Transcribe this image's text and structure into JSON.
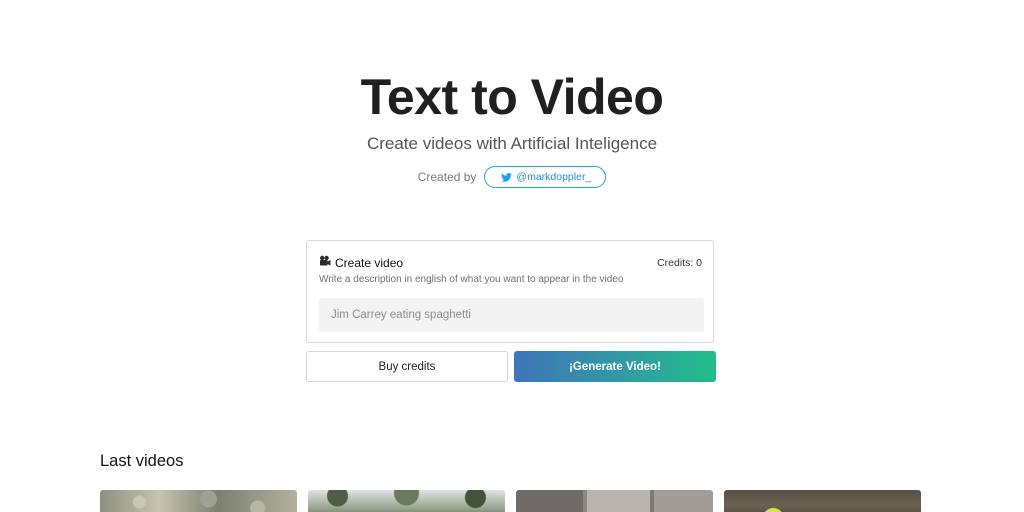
{
  "header": {
    "title": "Text to Video",
    "subtitle": "Create videos with Artificial Inteligence",
    "created_by_label": "Created by",
    "twitter_handle": "@markdoppler_"
  },
  "create_card": {
    "title": "Create video",
    "credits_label": "Credits: 0",
    "description": "Write a description in english of what you want to appear in the video",
    "input_placeholder": "Jim Carrey eating spaghetti",
    "input_value": ""
  },
  "actions": {
    "buy_label": "Buy credits",
    "generate_label": "¡Generate Video!"
  },
  "last_videos": {
    "title": "Last videos",
    "items": [
      {
        "icon": "video-thumbnail"
      },
      {
        "icon": "video-thumbnail"
      },
      {
        "icon": "video-thumbnail"
      },
      {
        "icon": "video-thumbnail"
      }
    ]
  },
  "colors": {
    "twitter": "#1da1f2",
    "generate_gradient_start": "#3f75b9",
    "generate_gradient_end": "#22bd88",
    "input_bg": "#f3f3f3"
  }
}
